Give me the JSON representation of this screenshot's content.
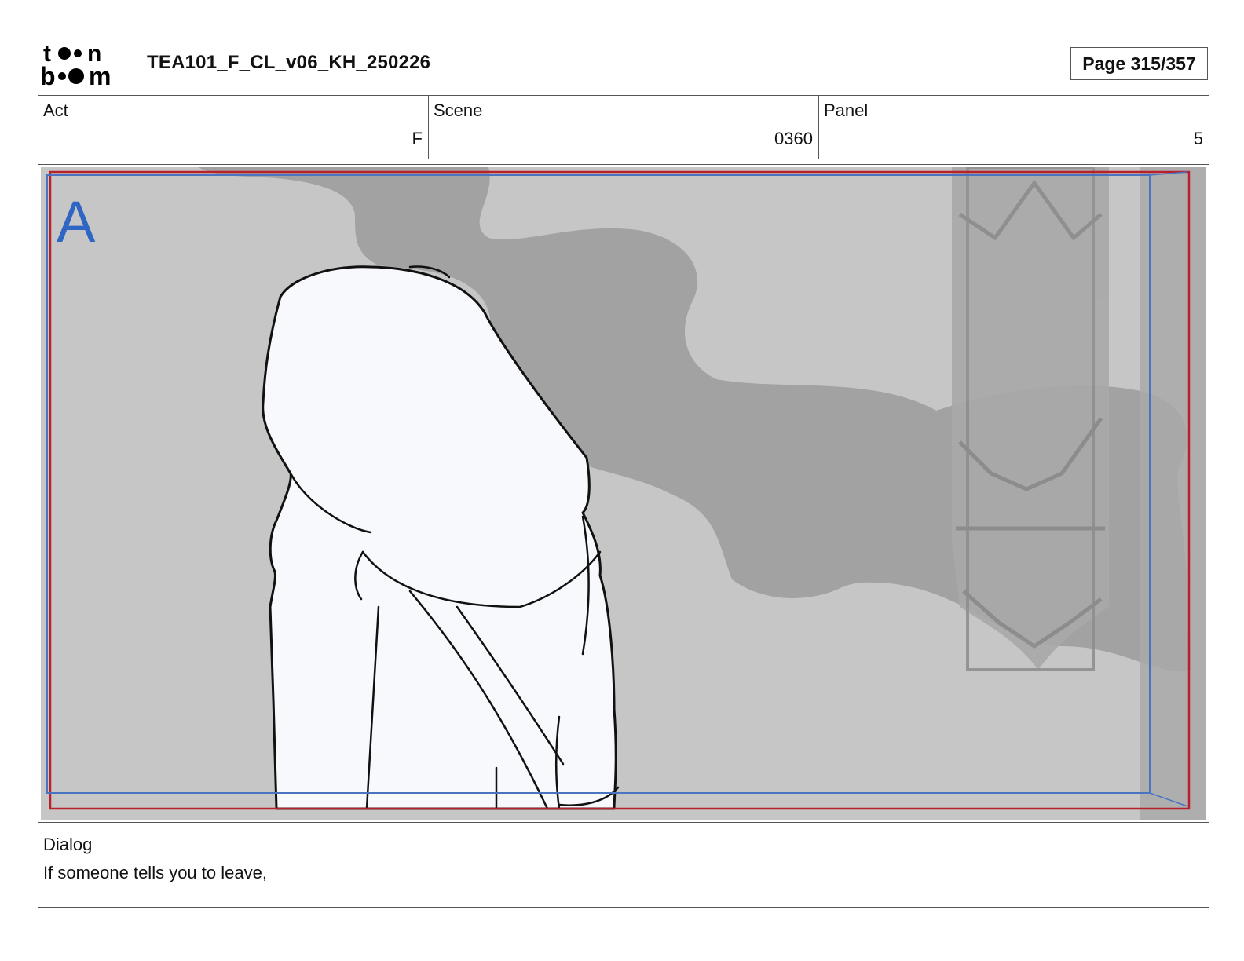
{
  "header": {
    "logo_text": "toon boom",
    "document_title": "TEA101_F_CL_v06_KH_250226",
    "page_label": "Page 315/357"
  },
  "info": {
    "act_label": "Act",
    "act_value": "F",
    "scene_label": "Scene",
    "scene_value": "0360",
    "panel_label": "Panel",
    "panel_value": "5"
  },
  "panel": {
    "layer_marker": "A",
    "colors": {
      "background": "#c6c6c6",
      "shadow": "#a2a2a2",
      "figure": "#f8f9fc",
      "safe_frame": "#b8212b",
      "camera_frame": "#4a73c0",
      "marker": "#2f66c4"
    }
  },
  "dialog": {
    "label": "Dialog",
    "text": "If someone tells you to leave,"
  }
}
